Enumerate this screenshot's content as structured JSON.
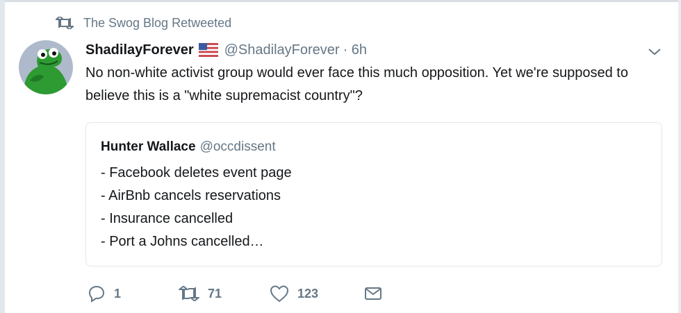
{
  "retweet_context": {
    "label": "The Swog Blog Retweeted"
  },
  "tweet": {
    "author_name": "ShadilayForever",
    "author_handle": "@ShadilayForever",
    "time": "· 6h",
    "text": "No non-white activist group would ever face this much opposition. Yet we're supposed to believe this is a \"white supremacist country\"?"
  },
  "quoted_tweet": {
    "author_name": "Hunter Wallace",
    "author_handle": "@occdissent",
    "lines": [
      "- Facebook deletes event page",
      "- AirBnb cancels reservations",
      "- Insurance cancelled",
      "- Port a Johns cancelled…"
    ]
  },
  "actions": {
    "reply_count": "1",
    "retweet_count": "71",
    "like_count": "123"
  },
  "colors": {
    "text": "#14171a",
    "secondary": "#657786",
    "border": "#e1e8ed",
    "avatar_bg": "#aeb9cc",
    "avatar_frog": "#2d9a32"
  },
  "icons": [
    "retweet-icon",
    "flag-icon",
    "chevron-down-icon",
    "reply-icon",
    "like-icon",
    "message-icon"
  ]
}
